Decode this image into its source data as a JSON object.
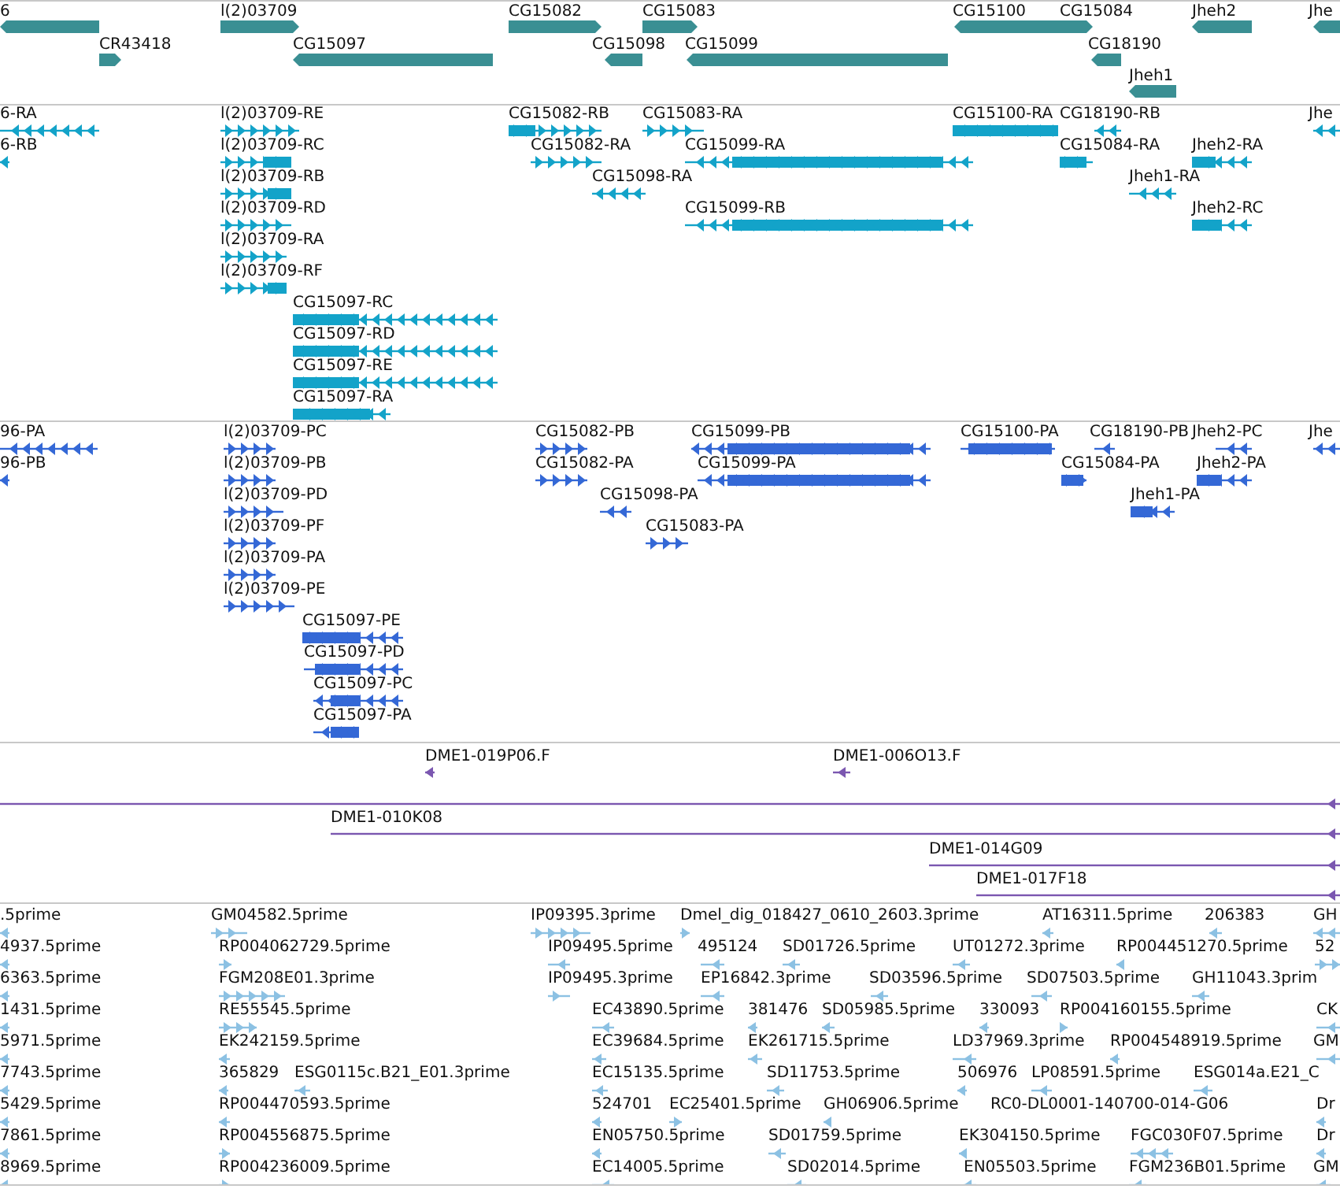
{
  "tracks": [
    {
      "kind": "gene",
      "features": [
        {
          "label": "6",
          "reverse": true
        },
        {
          "label": "CR43418",
          "reverse": false
        },
        {
          "label": "l(2)03709",
          "reverse": false
        },
        {
          "label": "CG15097",
          "reverse": true
        },
        {
          "label": "CG15082",
          "reverse": false
        },
        {
          "label": "CG15083",
          "reverse": false
        },
        {
          "label": "CG15098",
          "reverse": true
        },
        {
          "label": "CG15099",
          "reverse": true
        },
        {
          "label": "CG15100",
          "reverse": true
        },
        {
          "label": "CG15084",
          "reverse": false
        },
        {
          "label": "CG18190",
          "reverse": true
        },
        {
          "label": "Jheh2",
          "reverse": true
        },
        {
          "label": "Jhe",
          "reverse": true
        },
        {
          "label": "Jheh1",
          "reverse": true
        }
      ]
    },
    {
      "kind": "transcript",
      "features": [
        {
          "label": "6-RA",
          "reverse": true
        },
        {
          "label": "6-RB",
          "reverse": true
        },
        {
          "label": "l(2)03709-RE",
          "reverse": false
        },
        {
          "label": "l(2)03709-RC",
          "reverse": false
        },
        {
          "label": "l(2)03709-RB",
          "reverse": false
        },
        {
          "label": "l(2)03709-RD",
          "reverse": false
        },
        {
          "label": "l(2)03709-RA",
          "reverse": false
        },
        {
          "label": "l(2)03709-RF",
          "reverse": false
        },
        {
          "label": "CG15097-RC",
          "reverse": true
        },
        {
          "label": "CG15097-RD",
          "reverse": true
        },
        {
          "label": "CG15097-RE",
          "reverse": true
        },
        {
          "label": "CG15097-RA",
          "reverse": true
        },
        {
          "label": "CG15082-RB",
          "reverse": false
        },
        {
          "label": "CG15082-RA",
          "reverse": false
        },
        {
          "label": "CG15083-RA",
          "reverse": false
        },
        {
          "label": "CG15099-RA",
          "reverse": true
        },
        {
          "label": "CG15098-RA",
          "reverse": true
        },
        {
          "label": "CG15099-RB",
          "reverse": true
        },
        {
          "label": "CG15100-RA",
          "reverse": true
        },
        {
          "label": "CG18190-RB",
          "reverse": true
        },
        {
          "label": "CG15084-RA",
          "reverse": false
        },
        {
          "label": "Jheh2-RA",
          "reverse": true
        },
        {
          "label": "Jheh1-RA",
          "reverse": true
        },
        {
          "label": "Jheh2-RC",
          "reverse": true
        },
        {
          "label": "Jhe",
          "reverse": true
        }
      ]
    },
    {
      "kind": "protein",
      "features": [
        {
          "label": "96-PA",
          "reverse": true
        },
        {
          "label": "96-PB",
          "reverse": true
        },
        {
          "label": "l(2)03709-PC",
          "reverse": false
        },
        {
          "label": "l(2)03709-PB",
          "reverse": false
        },
        {
          "label": "l(2)03709-PD",
          "reverse": false
        },
        {
          "label": "l(2)03709-PF",
          "reverse": false
        },
        {
          "label": "l(2)03709-PA",
          "reverse": false
        },
        {
          "label": "l(2)03709-PE",
          "reverse": false
        },
        {
          "label": "CG15097-PE",
          "reverse": true
        },
        {
          "label": "CG15097-PD",
          "reverse": true
        },
        {
          "label": "CG15097-PC",
          "reverse": true
        },
        {
          "label": "CG15097-PA",
          "reverse": true
        },
        {
          "label": "CG15082-PB",
          "reverse": false
        },
        {
          "label": "CG15082-PA",
          "reverse": false
        },
        {
          "label": "CG15099-PB",
          "reverse": true
        },
        {
          "label": "CG15099-PA",
          "reverse": true
        },
        {
          "label": "CG15098-PA",
          "reverse": true
        },
        {
          "label": "CG15083-PA",
          "reverse": false
        },
        {
          "label": "CG15100-PA",
          "reverse": true
        },
        {
          "label": "CG18190-PB",
          "reverse": true
        },
        {
          "label": "CG15084-PA",
          "reverse": false
        },
        {
          "label": "Jheh2-PC",
          "reverse": true
        },
        {
          "label": "Jheh2-PA",
          "reverse": true
        },
        {
          "label": "Jheh1-PA",
          "reverse": true
        },
        {
          "label": "Jhe",
          "reverse": true
        }
      ]
    },
    {
      "kind": "clone",
      "features": [
        {
          "label": "DME1-019P06.F",
          "reverse": true
        },
        {
          "label": "DME1-006O13.F",
          "reverse": true
        },
        {
          "reverse": true
        },
        {
          "label": "DME1-010K08",
          "reverse": true
        },
        {
          "label": "DME1-014G09",
          "reverse": true
        },
        {
          "label": "DME1-017F18",
          "reverse": true
        }
      ]
    },
    {
      "kind": "est",
      "features": [
        {
          "label": ".5prime",
          "reverse": true
        },
        {
          "label": "4937.5prime",
          "reverse": true
        },
        {
          "label": "6363.5prime",
          "reverse": true
        },
        {
          "label": "1431.5prime",
          "reverse": true
        },
        {
          "label": "5971.5prime",
          "reverse": true
        },
        {
          "label": "7743.5prime",
          "reverse": true
        },
        {
          "label": "5429.5prime",
          "reverse": true
        },
        {
          "label": "7861.5prime",
          "reverse": true
        },
        {
          "label": "8969.5prime",
          "reverse": true
        },
        {
          "label": "GM04582.5prime",
          "reverse": false
        },
        {
          "label": "RP004062729.5prime",
          "reverse": false
        },
        {
          "label": "FGM208E01.3prime",
          "reverse": false
        },
        {
          "label": "RE55545.5prime",
          "reverse": false
        },
        {
          "label": "EK242159.5prime",
          "reverse": true
        },
        {
          "label": "365829",
          "reverse": true
        },
        {
          "label": "ESG0115c.B21_E01.3prime",
          "reverse": true
        },
        {
          "label": "RP004470593.5prime",
          "reverse": true
        },
        {
          "label": "RP004556875.5prime",
          "reverse": false
        },
        {
          "label": "RP004236009.5prime",
          "reverse": false
        },
        {
          "label": "IP09395.3prime",
          "reverse": false
        },
        {
          "label": "IP09495.5prime",
          "reverse": true
        },
        {
          "label": "IP09495.3prime",
          "reverse": false
        },
        {
          "label": "EC43890.5prime",
          "reverse": true
        },
        {
          "label": "EC39684.5prime",
          "reverse": true
        },
        {
          "label": "EC15135.5prime",
          "reverse": true
        },
        {
          "label": "524701",
          "reverse": true
        },
        {
          "label": "EN05750.5prime",
          "reverse": true
        },
        {
          "label": "EC14005.5prime",
          "reverse": true
        },
        {
          "label": "Dmel_dig_018427_0610_2603.3prime",
          "reverse": false
        },
        {
          "label": "AT16311.5prime",
          "reverse": true
        },
        {
          "label": "206383",
          "reverse": true
        },
        {
          "label": "GH",
          "reverse": true
        },
        {
          "label": "495124",
          "reverse": true
        },
        {
          "label": "SD01726.5prime",
          "reverse": true
        },
        {
          "label": "UT01272.3prime",
          "reverse": true
        },
        {
          "label": "RP004451270.5prime",
          "reverse": true
        },
        {
          "label": "52",
          "reverse": false
        },
        {
          "label": "EP16842.3prime",
          "reverse": true
        },
        {
          "label": "SD03596.5prime",
          "reverse": true
        },
        {
          "label": "SD07503.5prime",
          "reverse": true
        },
        {
          "label": "GH11043.3prim",
          "reverse": true
        },
        {
          "label": "381476",
          "reverse": true
        },
        {
          "label": "SD05985.5prime",
          "reverse": true
        },
        {
          "label": "330093",
          "reverse": true
        },
        {
          "label": "RP004160155.5prime",
          "reverse": false
        },
        {
          "label": "CK",
          "reverse": true
        },
        {
          "label": "EK261715.5prime",
          "reverse": true
        },
        {
          "label": "LD37969.3prime",
          "reverse": true
        },
        {
          "label": "RP004548919.5prime",
          "reverse": true
        },
        {
          "label": "GM",
          "reverse": true
        },
        {
          "label": "SD11753.5prime",
          "reverse": true
        },
        {
          "label": "506976",
          "reverse": true
        },
        {
          "label": "LP08591.5prime",
          "reverse": true
        },
        {
          "label": "ESG014a.E21_C",
          "reverse": true
        },
        {
          "label": "EC25401.5prime",
          "reverse": false
        },
        {
          "label": "GH06906.5prime",
          "reverse": true
        },
        {
          "label": "RC0-DL0001-140700-014-G06"
        },
        {
          "label": "Dr",
          "reverse": true
        },
        {
          "label": "SD01759.5prime",
          "reverse": true
        },
        {
          "label": "EK304150.5prime",
          "reverse": true
        },
        {
          "label": "FGC030F07.5prime",
          "reverse": true
        },
        {
          "label": "Dr",
          "reverse": true
        },
        {
          "label": "SD02014.5prime",
          "reverse": true
        },
        {
          "label": "EN05503.5prime",
          "reverse": true
        },
        {
          "label": "FGM236B01.5prime",
          "reverse": true
        },
        {
          "label": "GM",
          "reverse": true
        }
      ]
    }
  ]
}
